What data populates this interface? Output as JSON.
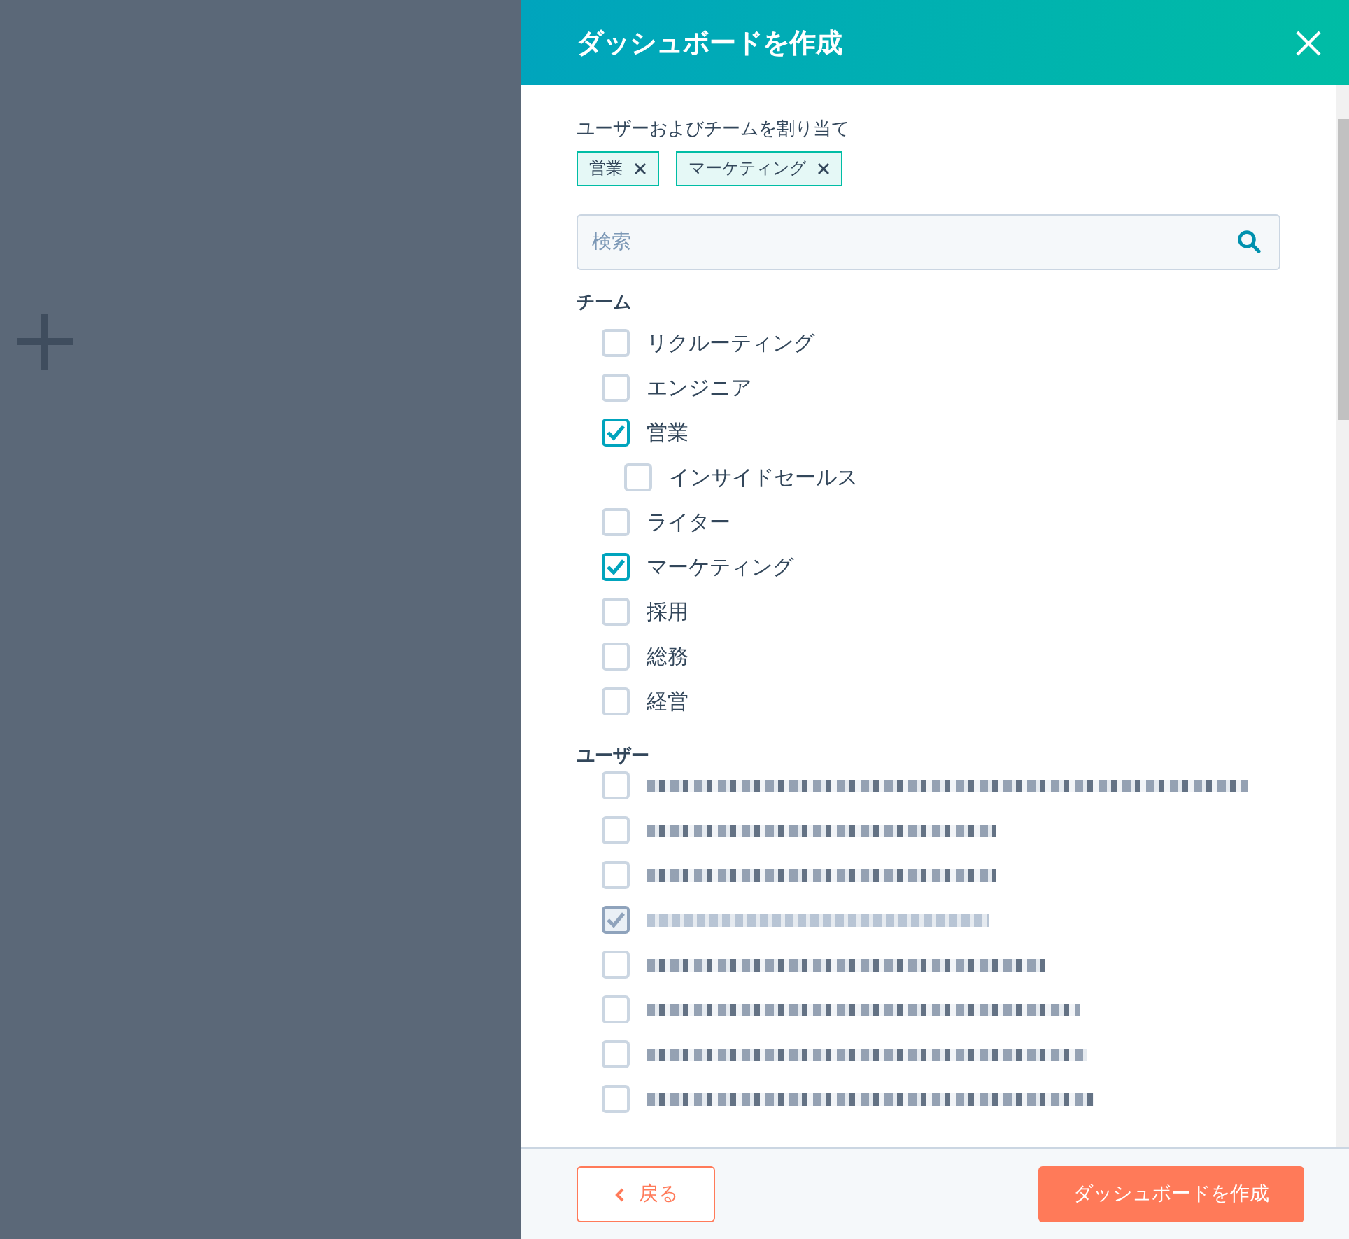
{
  "dialog": {
    "title": "ダッシュボードを作成",
    "assign_label": "ユーザーおよびチームを割り当て",
    "tags": [
      {
        "label": "営業"
      },
      {
        "label": "マーケティング"
      }
    ],
    "search": {
      "placeholder": "検索"
    },
    "teams_heading": "チーム",
    "teams": [
      {
        "label": "リクルーティング",
        "checked": false
      },
      {
        "label": "エンジニア",
        "checked": false
      },
      {
        "label": "営業",
        "checked": true,
        "children": [
          {
            "label": "インサイドセールス",
            "checked": false
          }
        ]
      },
      {
        "label": "ライター",
        "checked": false
      },
      {
        "label": "マーケティング",
        "checked": true
      },
      {
        "label": "採用",
        "checked": false
      },
      {
        "label": "総務",
        "checked": false
      },
      {
        "label": "経営",
        "checked": false
      }
    ],
    "users_heading": "ユーザー",
    "users": [
      {
        "checked": false,
        "disabled": false
      },
      {
        "checked": false,
        "disabled": false
      },
      {
        "checked": false,
        "disabled": false
      },
      {
        "checked": true,
        "disabled": true
      },
      {
        "checked": false,
        "disabled": false
      },
      {
        "checked": false,
        "disabled": false
      },
      {
        "checked": false,
        "disabled": false
      },
      {
        "checked": false,
        "disabled": false
      }
    ],
    "back_button": "戻る",
    "create_button": "ダッシュボードを作成"
  }
}
